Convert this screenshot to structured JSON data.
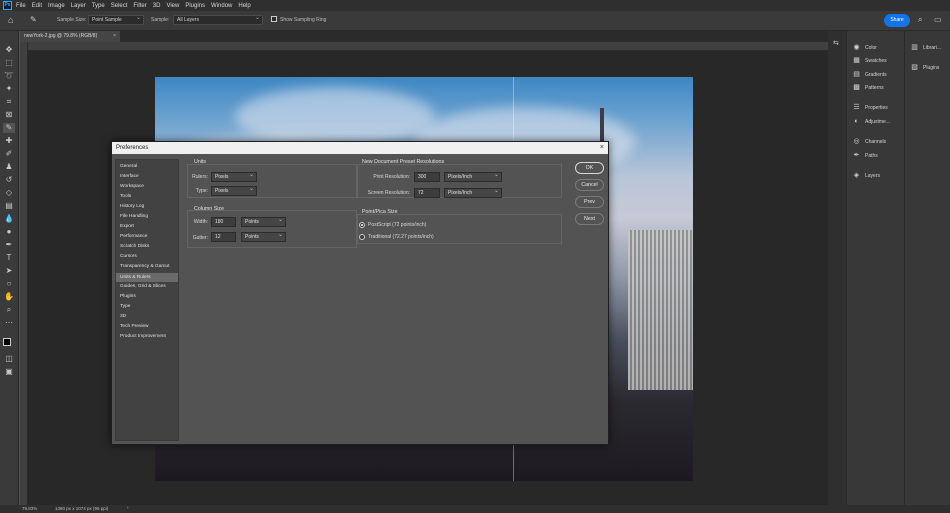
{
  "menu": {
    "logo": "Ps",
    "items": [
      "File",
      "Edit",
      "Image",
      "Layer",
      "Type",
      "Select",
      "Filter",
      "3D",
      "View",
      "Plugins",
      "Window",
      "Help"
    ]
  },
  "options_bar": {
    "sample_size_label": "Sample Size:",
    "sample_size_value": "Point Sample",
    "sample_label": "Sample:",
    "sample_value": "All Layers",
    "show_ring_label": "Show Sampling Ring",
    "share_label": "Share"
  },
  "document": {
    "tab_title": "newYork-2.jpg @ 79.8% (RGB/8)"
  },
  "status_bar": {
    "zoom": "79.83%",
    "info": "1360 px x 1074 px (96 ppi)"
  },
  "panels": {
    "col1": [
      "Color",
      "Swatches",
      "Gradients",
      "Patterns",
      "Properties",
      "Adjustme...",
      "Channels",
      "Paths",
      "Layers"
    ],
    "col2": [
      "Librari...",
      "Plugins"
    ]
  },
  "dialog": {
    "title": "Preferences",
    "categories": [
      "General",
      "Interface",
      "Workspace",
      "Tools",
      "History Log",
      "File Handling",
      "Export",
      "Performance",
      "Scratch Disks",
      "Cursors",
      "Transparency & Gamut",
      "Units & Rulers",
      "Guides, Grid & Slices",
      "Plugins",
      "Type",
      "3D",
      "Tech Preview",
      "Product Improvement"
    ],
    "selected_category_index": 11,
    "units": {
      "title": "Units",
      "rulers_label": "Rulers:",
      "rulers_value": "Pixels",
      "type_label": "Type:",
      "type_value": "Pixels"
    },
    "column_size": {
      "title": "Column Size",
      "width_label": "Width:",
      "width_value": "180",
      "width_unit": "Points",
      "gutter_label": "Gutter:",
      "gutter_value": "12",
      "gutter_unit": "Points"
    },
    "new_doc": {
      "title": "New Document Preset Resolutions",
      "print_label": "Print Resolution:",
      "print_value": "300",
      "print_unit": "Pixels/Inch",
      "screen_label": "Screen Resolution:",
      "screen_value": "72",
      "screen_unit": "Pixels/Inch"
    },
    "point_size": {
      "title": "Point/Pica Size",
      "option1": "PostScript (72 points/inch)",
      "option2": "Traditional (72.27 points/inch)",
      "selected": "PostScript (72 points/inch)"
    },
    "buttons": {
      "ok": "OK",
      "cancel": "Cancel",
      "prev": "Prev",
      "next": "Next"
    }
  }
}
